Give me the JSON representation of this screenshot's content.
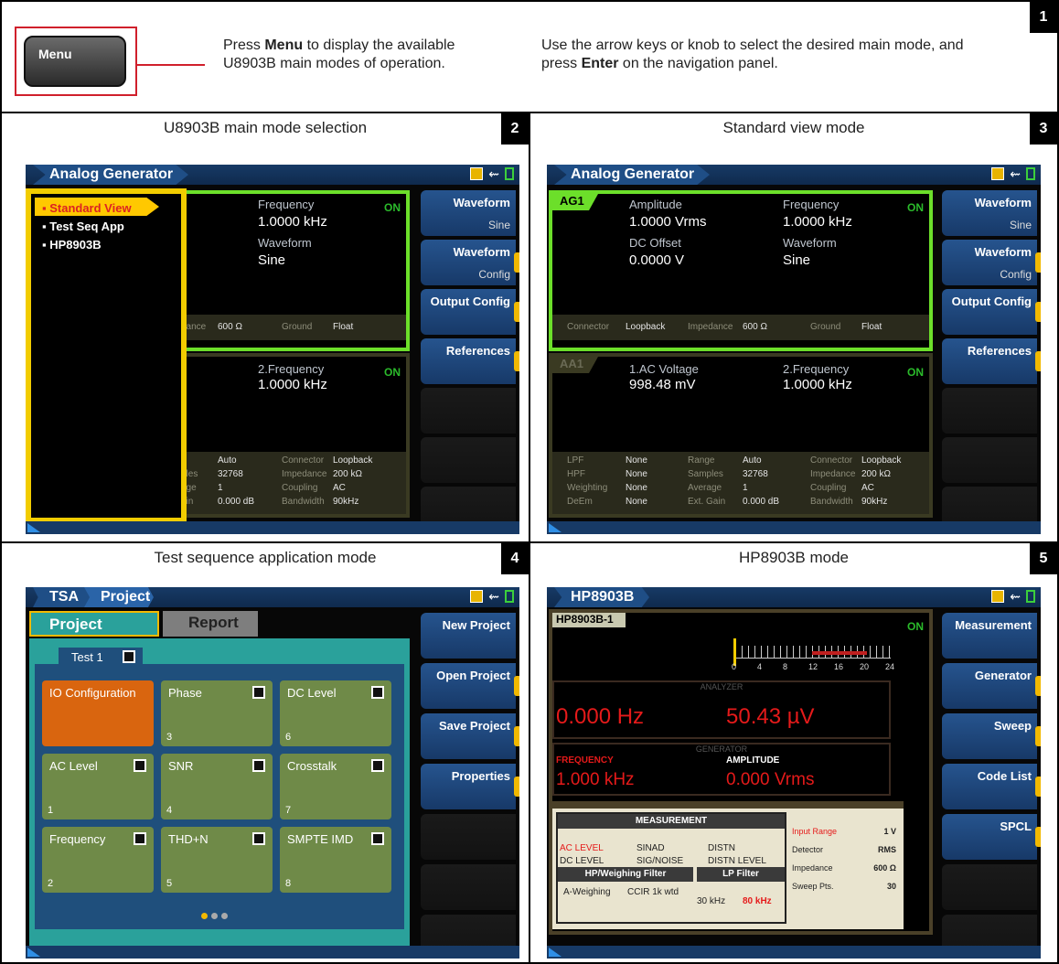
{
  "panel1": {
    "number": "1",
    "menu_key": "Menu",
    "text1_pre": "Press ",
    "text1_bold": "Menu",
    "text1_post": " to display the available U8903B main modes of operation.",
    "text2_pre": "Use the arrow keys or knob to select the desired main mode, and press ",
    "text2_bold": "Enter",
    "text2_post": " on the navigation panel."
  },
  "panel2": {
    "number": "2",
    "title": "U8903B main mode selection",
    "tag": "Analog Generator",
    "menu_items": [
      "Standard View",
      "Test Seq App",
      "HP8903B"
    ],
    "gen": {
      "l1": "Frequency",
      "v1": "1.0000 kHz",
      "l2": "Waveform",
      "v2": "Sine",
      "on": "ON",
      "f1": "dance",
      "f1v": "600 Ω",
      "f2": "Ground",
      "f2v": "Float"
    },
    "ana": {
      "l1": "2.Frequency",
      "v1": "1.0000 kHz",
      "on": "ON",
      "rows": [
        [
          "e",
          "Auto",
          "Connector",
          "Loopback"
        ],
        [
          "bles",
          "32768",
          "Impedance",
          "200 kΩ"
        ],
        [
          "age",
          "1",
          "Coupling",
          "AC"
        ],
        [
          "ain",
          "0.000 dB",
          "Bandwidth",
          "90kHz"
        ]
      ]
    },
    "softkeys": [
      {
        "label": "Waveform",
        "sub": "Sine"
      },
      {
        "label": "Waveform",
        "sub": "Config"
      },
      {
        "label": "Output Config",
        "sub": ""
      },
      {
        "label": "References",
        "sub": ""
      }
    ]
  },
  "panel3": {
    "number": "3",
    "title": "Standard view mode",
    "tag": "Analog Generator",
    "gen": {
      "ch": "AG1",
      "l1": "Amplitude",
      "v1": "1.0000 Vrms",
      "l2": "Frequency",
      "v2": "1.0000 kHz",
      "l3": "DC Offset",
      "v3": "0.0000 V",
      "l4": "Waveform",
      "v4": "Sine",
      "on": "ON",
      "foot": [
        "Connector",
        "Loopback",
        "Impedance",
        "600 Ω",
        "Ground",
        "Float"
      ]
    },
    "ana": {
      "ch": "AA1",
      "l1": "1.AC Voltage",
      "v1": "998.48 mV",
      "l2": "2.Frequency",
      "v2": "1.0000 kHz",
      "on": "ON",
      "rows": [
        [
          "LPF",
          "None",
          "Range",
          "Auto",
          "Connector",
          "Loopback"
        ],
        [
          "HPF",
          "None",
          "Samples",
          "32768",
          "Impedance",
          "200 kΩ"
        ],
        [
          "Weighting",
          "None",
          "Average",
          "1",
          "Coupling",
          "AC"
        ],
        [
          "DeEm",
          "None",
          "Ext. Gain",
          "0.000 dB",
          "Bandwidth",
          "90kHz"
        ]
      ]
    },
    "softkeys": [
      {
        "label": "Waveform",
        "sub": "Sine"
      },
      {
        "label": "Waveform",
        "sub": "Config"
      },
      {
        "label": "Output Config",
        "sub": ""
      },
      {
        "label": "References",
        "sub": ""
      }
    ]
  },
  "panel4": {
    "number": "4",
    "title": "Test sequence application mode",
    "tag1": "TSA",
    "tag2": "Project",
    "tab_project": "Project",
    "tab_report": "Report",
    "test": "Test 1",
    "cells": [
      {
        "label": "IO Configuration",
        "n": ""
      },
      {
        "label": "Phase",
        "n": "3"
      },
      {
        "label": "DC Level",
        "n": "6"
      },
      {
        "label": "AC Level",
        "n": "1"
      },
      {
        "label": "SNR",
        "n": "4"
      },
      {
        "label": "Crosstalk",
        "n": "7"
      },
      {
        "label": "Frequency",
        "n": "2"
      },
      {
        "label": "THD+N",
        "n": "5"
      },
      {
        "label": "SMPTE IMD",
        "n": "8"
      }
    ],
    "softkeys": [
      {
        "label": "New Project"
      },
      {
        "label": "Open Project"
      },
      {
        "label": "Save Project"
      },
      {
        "label": "Properties"
      }
    ]
  },
  "panel5": {
    "number": "5",
    "title": "HP8903B mode",
    "tag": "HP8903B",
    "id": "HP8903B-1",
    "on": "ON",
    "scale": [
      "0",
      "4",
      "8",
      "12",
      "16",
      "20",
      "24"
    ],
    "analyzer": "ANALYZER",
    "freq": "0.000 Hz",
    "level": "50.43 µV",
    "generator": "GENERATOR",
    "gen_freq_label": "FREQUENCY",
    "gen_amp_label": "AMPLITUDE",
    "gen_freq": "1.000 kHz",
    "gen_amp": "0.000 Vrms",
    "meas": {
      "title": "MEASUREMENT",
      "r1": [
        "AC LEVEL",
        "SINAD",
        "DISTN"
      ],
      "r2": [
        "DC LEVEL",
        "SIG/NOISE",
        "DISTN LEVEL"
      ],
      "hp": "HP/Weighing Filter",
      "lp": "LP Filter",
      "hpv1": "A-Weighing",
      "hpv2": "CCIR 1k wtd",
      "lpv1": "30 kHz",
      "lpv2": "80 kHz"
    },
    "info": [
      [
        "Input Range",
        "1 V"
      ],
      [
        "Detector",
        "RMS"
      ],
      [
        "Impedance",
        "600 Ω"
      ],
      [
        "Sweep Pts.",
        "30"
      ]
    ],
    "softkeys": [
      {
        "label": "Measurement"
      },
      {
        "label": "Generator"
      },
      {
        "label": "Sweep"
      },
      {
        "label": "Code List"
      },
      {
        "label": "SPCL"
      }
    ]
  },
  "colors": {
    "green": "#6cdf2a",
    "yellow": "#f2b900",
    "blue": "#1f4e86",
    "red": "#e51a1a"
  }
}
